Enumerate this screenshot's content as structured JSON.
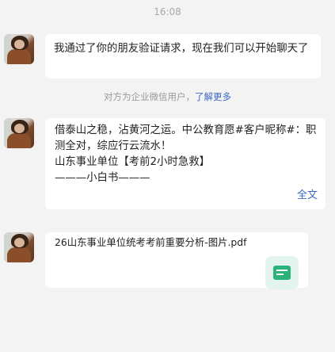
{
  "timestamp": "16:08",
  "messages": [
    {
      "text": "我通过了你的朋友验证请求，现在我们可以开始聊天了"
    },
    {
      "text": "借泰山之稳，沾黄河之运。中公教育愿#客户昵称#：职测全对，综应行云流水！\n山东事业单位【考前2小时急救】\n———小白书———",
      "expand_label": "全文"
    },
    {
      "file_name": "26山东事业单位统考考前重要分析-图片.pdf",
      "file_icon": "file-icon"
    }
  ],
  "notice": {
    "text": "对方为企业微信用户，",
    "link": "了解更多"
  },
  "colors": {
    "background": "#f3f3f3",
    "bubble": "#ffffff",
    "link": "#3a68c4",
    "file_icon": "#2cb37a"
  }
}
